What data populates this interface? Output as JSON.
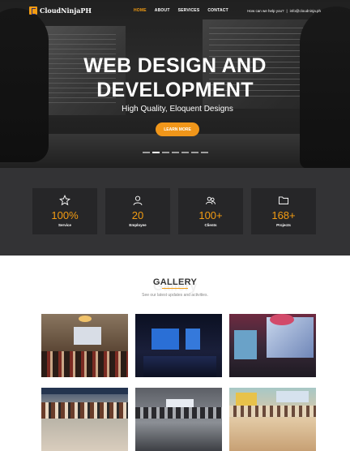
{
  "brand": {
    "name": "CloudNinjaPH",
    "logo_letter": "E"
  },
  "nav": {
    "items": [
      {
        "label": "HOME",
        "active": true
      },
      {
        "label": "ABOUT",
        "active": false
      },
      {
        "label": "SERVICES",
        "active": false
      },
      {
        "label": "CONTACT",
        "active": false
      }
    ],
    "help_text": "How can we help you?",
    "separator": "|",
    "email": "info@cloudninja.ph"
  },
  "hero": {
    "title_line1": "WEB DESIGN AND",
    "title_line2": "DEVELOPMENT",
    "subtitle": "High Quality, Eloquent Designs",
    "button_label": "LEARN MORE",
    "slide_count": 7,
    "active_slide": 1
  },
  "stats": [
    {
      "value": "100%",
      "label": "Service",
      "icon": "star-icon"
    },
    {
      "value": "20",
      "label": "Employee",
      "icon": "user-icon"
    },
    {
      "value": "100+",
      "label": "Clients",
      "icon": "users-icon"
    },
    {
      "value": "168+",
      "label": "Projects",
      "icon": "folder-icon"
    }
  ],
  "gallery": {
    "title": "GALLERY",
    "ghost_title": "Gallery",
    "subtitle": "See our latest updates and activities.",
    "photos": [
      "event-hall-photo",
      "microsoft-stage-photo",
      "presenter-photo",
      "group-photo",
      "conference-photo",
      "classroom-photo"
    ]
  },
  "colors": {
    "accent": "#f39c12",
    "stats_bg": "#333335",
    "stat_card_bg": "#262628"
  }
}
